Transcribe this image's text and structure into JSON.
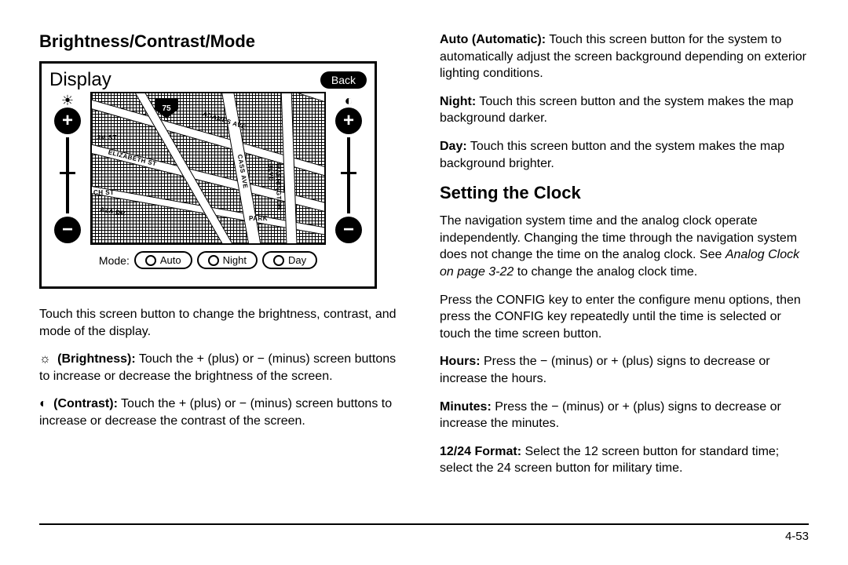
{
  "left": {
    "heading": "Brightness/Contrast/Mode",
    "screen": {
      "title": "Display",
      "back": "Back",
      "route": "75",
      "streets": {
        "adames": "ADAMES AVE",
        "jm": "JM ST",
        "elizabeth": "ELIZABETH ST",
        "ch": "CH ST",
        "aza": "AZA DR",
        "cass": "CASS AVE",
        "washington": "WASHINGTON BLVD",
        "park": "PARK"
      },
      "mode_label": "Mode:",
      "modes": {
        "auto": "Auto",
        "night": "Night",
        "day": "Day"
      },
      "plus": "+",
      "minus": "−"
    },
    "intro": "Touch this screen button to change the brightness, contrast, and mode of the display.",
    "brightness_icon": "☼",
    "brightness_label": "(Brightness):",
    "brightness_text": " Touch the + (plus) or − (minus) screen buttons to increase or decrease the brightness of the screen.",
    "contrast_icon": "◐",
    "contrast_label": "(Contrast):",
    "contrast_text": " Touch the + (plus) or − (minus) screen buttons to increase or decrease the contrast of the screen."
  },
  "right": {
    "auto_label": "Auto (Automatic):",
    "auto_text": " Touch this screen button for the system to automatically adjust the screen background depending on exterior lighting conditions.",
    "night_label": "Night:",
    "night_text": " Touch this screen button and the system makes the map background darker.",
    "day_label": "Day:",
    "day_text": " Touch this screen button and the system makes the map background brighter.",
    "clock_heading": "Setting the Clock",
    "clock_p1a": "The navigation system time and the analog clock operate independently. Changing the time through the navigation system does not change the time on the analog clock. See ",
    "clock_p1_ref": "Analog Clock on page 3-22",
    "clock_p1b": " to change the analog clock time.",
    "clock_p2": "Press the CONFIG key to enter the configure menu options, then press the CONFIG key repeatedly until the time is selected or touch the time screen button.",
    "hours_label": "Hours:",
    "hours_text": " Press the − (minus) or + (plus) signs to decrease or increase the hours.",
    "minutes_label": "Minutes:",
    "minutes_text": " Press the − (minus) or + (plus) signs to decrease or increase the minutes.",
    "format_label": "12/24 Format:",
    "format_text": " Select the 12 screen button for standard time; select the 24 screen button for military time."
  },
  "page_number": "4-53"
}
